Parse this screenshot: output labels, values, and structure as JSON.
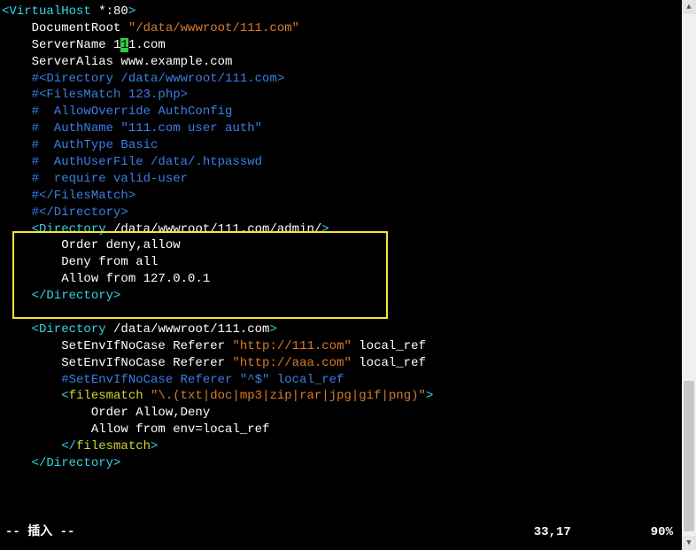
{
  "lines": [
    [
      {
        "cls": "cy",
        "t": "<VirtualHost "
      },
      {
        "cls": "w",
        "t": "*:80"
      },
      {
        "cls": "cy",
        "t": ">"
      }
    ],
    [
      {
        "cls": "w",
        "t": "    DocumentRoot "
      },
      {
        "cls": "or",
        "t": "\"/data/wwwroot/111.com\""
      }
    ],
    [
      {
        "cls": "w",
        "t": "    ServerName 1"
      },
      {
        "cls": "cursor",
        "t": "1"
      },
      {
        "cls": "w",
        "t": "1.com"
      }
    ],
    [
      {
        "cls": "w",
        "t": "    ServerAlias www.example.com"
      }
    ],
    [
      {
        "cls": "bl",
        "t": "    #<Directory /data/wwwroot/111.com>"
      }
    ],
    [
      {
        "cls": "bl",
        "t": "    #<FilesMatch 123.php>"
      }
    ],
    [
      {
        "cls": "bl",
        "t": "    #  AllowOverride AuthConfig"
      }
    ],
    [
      {
        "cls": "bl",
        "t": "    #  AuthName \"111.com user auth\""
      }
    ],
    [
      {
        "cls": "bl",
        "t": "    #  AuthType Basic"
      }
    ],
    [
      {
        "cls": "bl",
        "t": "    #  AuthUserFile /data/.htpasswd"
      }
    ],
    [
      {
        "cls": "bl",
        "t": "    #  require valid-user"
      }
    ],
    [
      {
        "cls": "bl",
        "t": "    #</FilesMatch>"
      }
    ],
    [
      {
        "cls": "bl",
        "t": "    #</Directory>"
      }
    ],
    [
      {
        "cls": "cy",
        "t": "    <Directory "
      },
      {
        "cls": "w",
        "t": "/data/wwwroot/111.com/admin/"
      },
      {
        "cls": "cy",
        "t": ">"
      }
    ],
    [
      {
        "cls": "w",
        "t": "        Order deny,allow"
      }
    ],
    [
      {
        "cls": "w",
        "t": "        Deny from all"
      }
    ],
    [
      {
        "cls": "w",
        "t": "        Allow from 127.0.0.1"
      }
    ],
    [
      {
        "cls": "cy",
        "t": "    </Directory>"
      }
    ],
    [
      {
        "cls": "w",
        "t": ""
      }
    ],
    [
      {
        "cls": "cy",
        "t": "    <Directory "
      },
      {
        "cls": "w",
        "t": "/data/wwwroot/111.com"
      },
      {
        "cls": "cy",
        "t": ">"
      }
    ],
    [
      {
        "cls": "w",
        "t": "        SetEnvIfNoCase Referer "
      },
      {
        "cls": "or",
        "t": "\"http://111.com\""
      },
      {
        "cls": "w",
        "t": " local_ref"
      }
    ],
    [
      {
        "cls": "w",
        "t": "        SetEnvIfNoCase Referer "
      },
      {
        "cls": "or",
        "t": "\"http://aaa.com\""
      },
      {
        "cls": "w",
        "t": " local_ref"
      }
    ],
    [
      {
        "cls": "bl",
        "t": "        #SetEnvIfNoCase Referer \"^$\" local_ref"
      }
    ],
    [
      {
        "cls": "cy",
        "t": "        <"
      },
      {
        "cls": "kw",
        "t": "filesmatch"
      },
      {
        "cls": "cy",
        "t": " "
      },
      {
        "cls": "or",
        "t": "\"\\.(txt|doc|mp3|zip|rar|jpg|gif|png)\""
      },
      {
        "cls": "cy",
        "t": ">"
      }
    ],
    [
      {
        "cls": "w",
        "t": "            Order Allow,Deny"
      }
    ],
    [
      {
        "cls": "w",
        "t": "            Allow from env=local_ref"
      }
    ],
    [
      {
        "cls": "cy",
        "t": "        </"
      },
      {
        "cls": "kw",
        "t": "filesmatch"
      },
      {
        "cls": "cy",
        "t": ">"
      }
    ],
    [
      {
        "cls": "cy",
        "t": "    </Directory>"
      }
    ]
  ],
  "status": {
    "mode": "-- 插入 --",
    "position": "33,17",
    "percent": "90%"
  }
}
